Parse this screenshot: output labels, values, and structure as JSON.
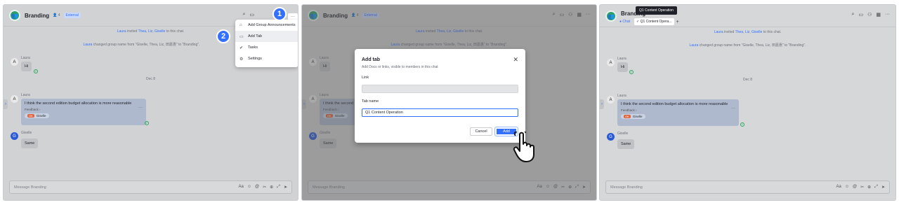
{
  "chat": {
    "title": "Branding",
    "member_count": "4",
    "external_badge": "External",
    "system_invite": [
      "Laura",
      " invited ",
      "Thea",
      ", ",
      "Liz",
      ", ",
      "Giselle",
      " to this chat."
    ],
    "system_rename": [
      "Laura",
      " changed group name from \"Giselle, Thea, Liz, 田嘉惠\" to \"Branding\"."
    ],
    "date_divider": "Dec 8",
    "messages": [
      {
        "sender": "Laura",
        "avatar": "A",
        "text": "Hi"
      },
      {
        "sender": "Laura",
        "avatar": "A",
        "text": "I think the second edition budget allocation is more reasonable",
        "sub": "Feedback ›",
        "reaction_emoji": "OK",
        "reaction_user": "Giselle"
      },
      {
        "sender": "Giselle",
        "avatar": "G",
        "text": "Same"
      }
    ],
    "input_placeholder": "Message Branding"
  },
  "menu": {
    "items": [
      "Add Group Announcements",
      "Add Tab",
      "Tasks",
      "Settings"
    ]
  },
  "steps": [
    "1",
    "2"
  ],
  "dialog": {
    "title": "Add tab",
    "subtitle": "Add Docs or links, visible to members in this chat",
    "link_label": "Link",
    "tab_name_label": "Tab name",
    "tab_name_value": "Q1 Content Operation",
    "cancel": "Cancel",
    "add": "Add"
  },
  "tabs": {
    "chat": "Chat",
    "new_tab": "Q1 Content Opera...",
    "tooltip": "Q1 Content Operation",
    "add_symbol": "+"
  },
  "colors": {
    "accent": "#3370ff",
    "group_avatar": "#2f9e69"
  }
}
